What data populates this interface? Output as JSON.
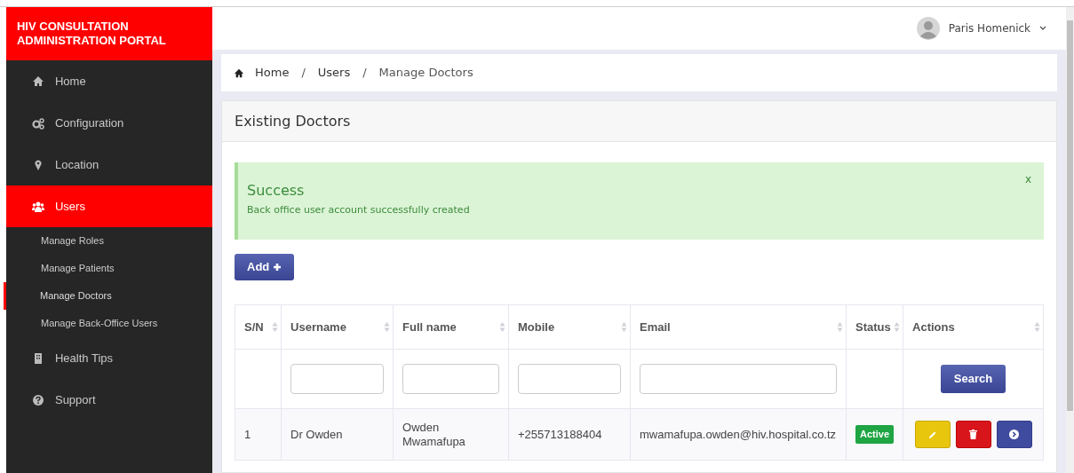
{
  "brand": "HIV CONSULTATION ADMINISTRATION PORTAL",
  "user": {
    "name": "Paris Homenick"
  },
  "sidebar": {
    "items": [
      {
        "label": "Home",
        "selected": false
      },
      {
        "label": "Configuration",
        "selected": false
      },
      {
        "label": "Location",
        "selected": false
      },
      {
        "label": "Users",
        "selected": true,
        "children": [
          {
            "label": "Manage Roles",
            "selected": false
          },
          {
            "label": "Manage Patients",
            "selected": false
          },
          {
            "label": "Manage Doctors",
            "selected": true
          },
          {
            "label": "Manage Back-Office Users",
            "selected": false
          }
        ]
      },
      {
        "label": "Health Tips",
        "selected": false
      },
      {
        "label": "Support",
        "selected": false
      }
    ]
  },
  "breadcrumb": [
    {
      "kind": "link",
      "text": "Home"
    },
    {
      "kind": "separator",
      "text": "/"
    },
    {
      "kind": "link",
      "text": "Users"
    },
    {
      "kind": "separator",
      "text": "/"
    },
    {
      "kind": "current",
      "text": "Manage Doctors"
    }
  ],
  "panel": {
    "title": "Existing Doctors",
    "alert": {
      "title": "Success",
      "message": "Back office user account successfully created",
      "close": "x"
    },
    "add_button": "Add",
    "table": {
      "columns": [
        "S/N",
        "Username",
        "Full name",
        "Mobile",
        "Email",
        "Status",
        "Actions"
      ],
      "search_button": "Search",
      "rows": [
        {
          "sn": "1",
          "username": "Dr Owden",
          "full_name": "Owden Mwamafupa",
          "mobile": "+255713188404",
          "email": "mwamafupa.owden@hiv.hospital.co.tz",
          "status": "Active"
        }
      ]
    }
  }
}
